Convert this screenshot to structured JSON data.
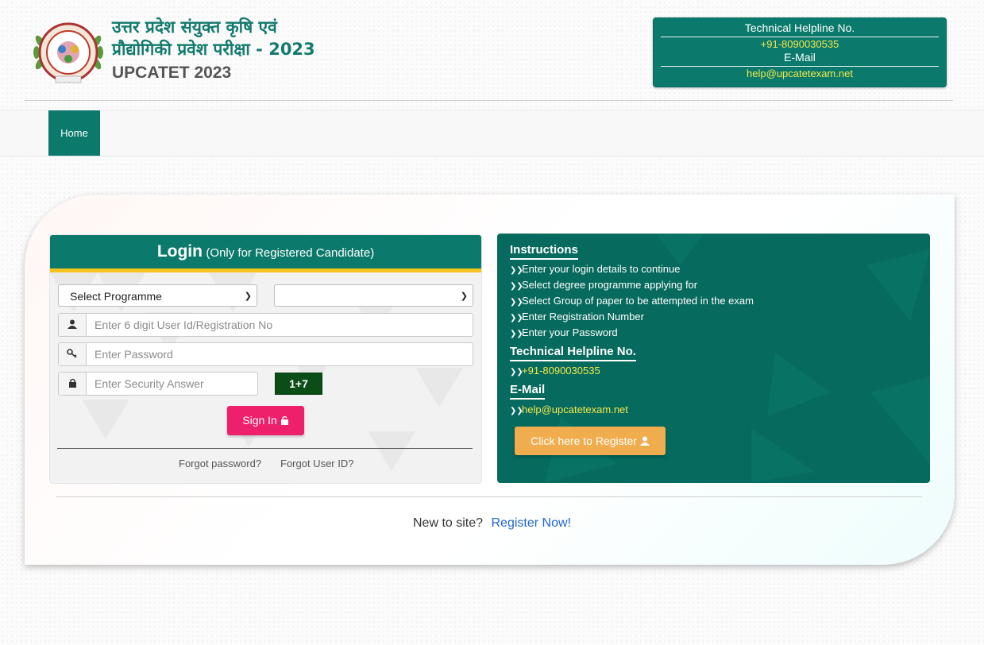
{
  "header": {
    "title_hi_line1": "उत्तर प्रदेश संयुक्त कृषि एवं",
    "title_hi_line2": "प्रौद्योगिकी प्रवेश परीक्षा - 2023",
    "title_en": "UPCATET 2023",
    "helpline": {
      "title": "Technical Helpline No.",
      "phone": "+91-8090030535",
      "mail_label": "E-Mail",
      "mail": "help@upcatetexam.net"
    }
  },
  "nav": {
    "home": "Home"
  },
  "login": {
    "title": "Login",
    "subtitle": "(Only for Registered Candidate)",
    "programme_select": "Select Programme",
    "group_select": "",
    "user_placeholder": "Enter 6 digit User Id/Registration No",
    "password_placeholder": "Enter Password",
    "security_placeholder": "Enter Security Answer",
    "captcha": "1+7",
    "signin": "Sign In",
    "forgot_password": "Forgot password?",
    "forgot_userid": "Forgot User ID?"
  },
  "instructions": {
    "heading": "Instructions",
    "items": [
      "Enter your login details to continue",
      "Select degree programme applying for",
      "Select Group of paper to be attempted in the exam",
      "Enter Registration Number",
      "Enter your Password"
    ],
    "helpline_heading": "Technical Helpline No.",
    "helpline_phone": "+91-8090030535",
    "email_heading": "E-Mail",
    "email": "help@upcatetexam.net",
    "register_button": "Click here to Register"
  },
  "footer": {
    "new_to_site": "New to site?",
    "register_now": "Register Now!"
  },
  "colors": {
    "primary": "#0b7a6c",
    "accent_yellow": "#f3e94a",
    "signin": "#ee1f6b",
    "register": "#f0ad4e",
    "captcha": "#0a4d16"
  }
}
